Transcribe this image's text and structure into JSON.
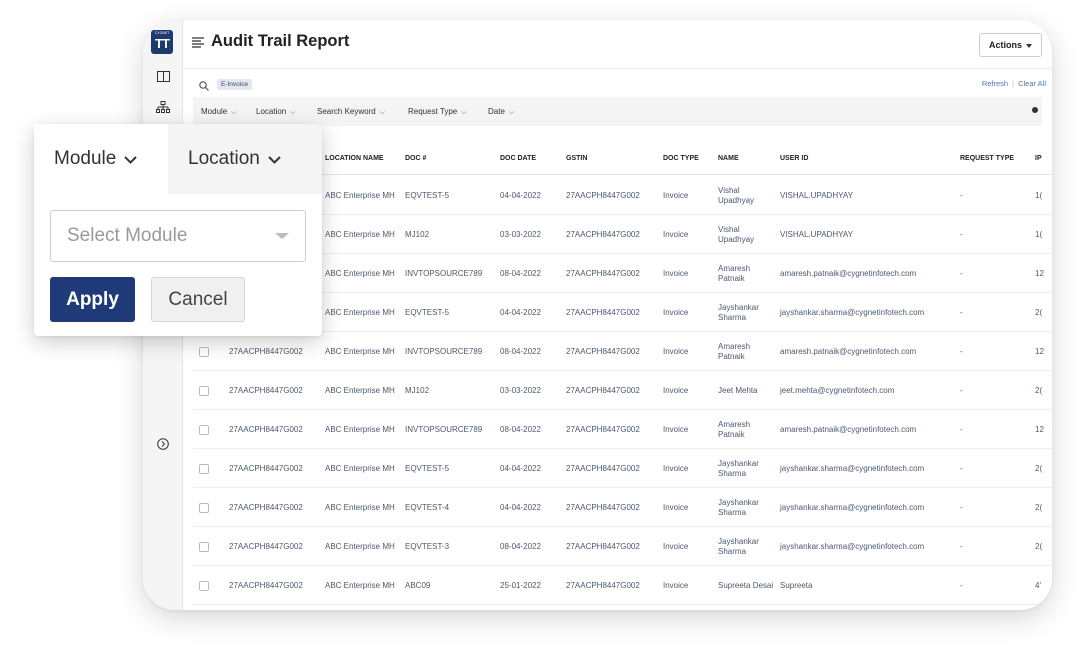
{
  "app": {
    "logo_small": "CYGNET",
    "logo_big": "TT"
  },
  "header": {
    "title": "Audit Trail Report",
    "actions_label": "Actions"
  },
  "search": {
    "chip": "E-Invoice",
    "refresh": "Refresh",
    "clear_all": "Clear All"
  },
  "filters": [
    "Module",
    "Location",
    "Search Keyword",
    "Request Type",
    "Date"
  ],
  "table": {
    "columns": [
      "LOCATION NAME",
      "DOC #",
      "DOC DATE",
      "GSTIN",
      "DOC TYPE",
      "NAME",
      "USER ID",
      "REQUEST TYPE",
      "IP"
    ],
    "rows": [
      {
        "gstin_main": "",
        "location": "ABC Enterprise MH",
        "doc": "EQVTEST-5",
        "date": "04-04-2022",
        "gstin": "27AACPH8447G002",
        "type": "Invoice",
        "name": "Vishal Upadhyay",
        "user": "VISHAL.UPADHYAY",
        "req": "-",
        "ip": "1("
      },
      {
        "gstin_main": "",
        "location": "ABC Enterprise MH",
        "doc": "MJ102",
        "date": "03-03-2022",
        "gstin": "27AACPH8447G002",
        "type": "Invoice",
        "name": "Vishal Upadhyay",
        "user": "VISHAL.UPADHYAY",
        "req": "-",
        "ip": "1("
      },
      {
        "gstin_main": "",
        "location": "ABC Enterprise MH",
        "doc": "INVTOPSOURCE789",
        "date": "08-04-2022",
        "gstin": "27AACPH8447G002",
        "type": "Invoice",
        "name": "Amaresh Patnaik",
        "user": "amaresh.patnaik@cygnetinfotech.com",
        "req": "-",
        "ip": "12"
      },
      {
        "gstin_main": "",
        "location": "ABC Enterprise MH",
        "doc": "EQVTEST-5",
        "date": "04-04-2022",
        "gstin": "27AACPH8447G002",
        "type": "Invoice",
        "name": "Jayshankar Sharma",
        "user": "jayshankar.sharma@cygnetinfotech.com",
        "req": "-",
        "ip": "2("
      },
      {
        "gstin_main": "27AACPH8447G002",
        "location": "ABC Enterprise MH",
        "doc": "INVTOPSOURCE789",
        "date": "08-04-2022",
        "gstin": "27AACPH8447G002",
        "type": "Invoice",
        "name": "Amaresh Patnaik",
        "user": "amaresh.patnaik@cygnetinfotech.com",
        "req": "-",
        "ip": "12"
      },
      {
        "gstin_main": "27AACPH8447G002",
        "location": "ABC Enterprise MH",
        "doc": "MJ102",
        "date": "03-03-2022",
        "gstin": "27AACPH8447G002",
        "type": "Invoice",
        "name": "Jeet Mehta",
        "user": "jeet.mehta@cygnetinfotech.com",
        "req": "-",
        "ip": "2("
      },
      {
        "gstin_main": "27AACPH8447G002",
        "location": "ABC Enterprise MH",
        "doc": "INVTOPSOURCE789",
        "date": "08-04-2022",
        "gstin": "27AACPH8447G002",
        "type": "Invoice",
        "name": "Amaresh Patnaik",
        "user": "amaresh.patnaik@cygnetinfotech.com",
        "req": "-",
        "ip": "12"
      },
      {
        "gstin_main": "27AACPH8447G002",
        "location": "ABC Enterprise MH",
        "doc": "EQVTEST-5",
        "date": "04-04-2022",
        "gstin": "27AACPH8447G002",
        "type": "Invoice",
        "name": "Jayshankar Sharma",
        "user": "jayshankar.sharma@cygnetinfotech.com",
        "req": "-",
        "ip": "2("
      },
      {
        "gstin_main": "27AACPH8447G002",
        "location": "ABC Enterprise MH",
        "doc": "EQVTEST-4",
        "date": "04-04-2022",
        "gstin": "27AACPH8447G002",
        "type": "Invoice",
        "name": "Jayshankar Sharma",
        "user": "jayshankar.sharma@cygnetinfotech.com",
        "req": "-",
        "ip": "2("
      },
      {
        "gstin_main": "27AACPH8447G002",
        "location": "ABC Enterprise MH",
        "doc": "EQVTEST-3",
        "date": "08-04-2022",
        "gstin": "27AACPH8447G002",
        "type": "Invoice",
        "name": "Jayshankar Sharma",
        "user": "jayshankar.sharma@cygnetinfotech.com",
        "req": "-",
        "ip": "2("
      },
      {
        "gstin_main": "27AACPH8447G002",
        "location": "ABC Enterprise MH",
        "doc": "ABC09",
        "date": "25-01-2022",
        "gstin": "27AACPH8447G002",
        "type": "Invoice",
        "name": "Supreeta Desai",
        "user": "Supreeta",
        "req": "-",
        "ip": "4'"
      }
    ]
  },
  "popup": {
    "tab_module": "Module",
    "tab_location": "Location",
    "select_placeholder": "Select Module",
    "apply": "Apply",
    "cancel": "Cancel"
  }
}
